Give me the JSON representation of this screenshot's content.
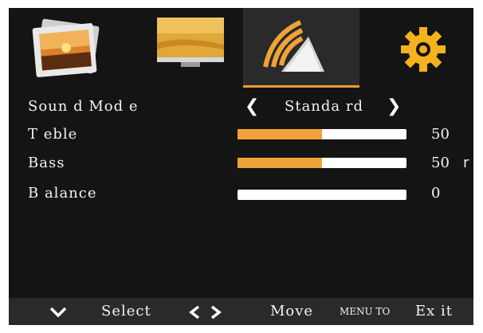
{
  "tabs": [
    {
      "name": "picture-tab",
      "icon": "photo-stack-icon"
    },
    {
      "name": "screen-tab",
      "icon": "monitor-image-icon"
    },
    {
      "name": "sound-tab",
      "icon": "speaker-waves-icon",
      "active": true
    },
    {
      "name": "setup-tab",
      "icon": "gear-icon"
    }
  ],
  "menu": {
    "sound_mode": {
      "label": "Soun d Mod e",
      "value": "Standa rd"
    },
    "treble": {
      "label": "T eble",
      "value": "50",
      "level": 0.5
    },
    "bass": {
      "label": "Bass",
      "value": "50",
      "suffix": "r",
      "level": 0.5
    },
    "balance": {
      "label": "B alance",
      "value": "0",
      "level": 0
    }
  },
  "footer": {
    "select_label": "Select",
    "move_label": "Move",
    "menu_to_label": "MENU TO",
    "exit_label": "Ex it"
  },
  "colors": {
    "background": "#141414",
    "accent": "#f0a23a",
    "bar_track": "#ffffff",
    "active_tab": "#2a2a2a"
  }
}
